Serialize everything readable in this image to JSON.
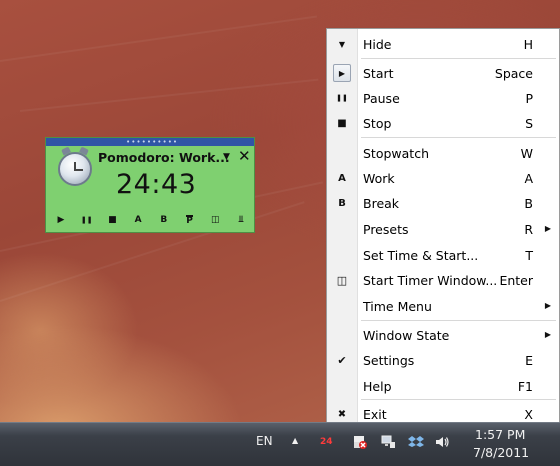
{
  "widget": {
    "title": "Pomodoro: Work...",
    "time": "24:43",
    "grip": "••••••••••",
    "controls": [
      {
        "name": "start-icon",
        "glyph": "▶"
      },
      {
        "name": "pause-icon",
        "glyph": "❚❚"
      },
      {
        "name": "stop-icon",
        "glyph": "■"
      },
      {
        "name": "work-icon",
        "glyph": "A"
      },
      {
        "name": "break-icon",
        "glyph": "B"
      },
      {
        "name": "presets-icon",
        "glyph": "P"
      },
      {
        "name": "timer-window-icon",
        "glyph": "◫"
      },
      {
        "name": "pin-icon",
        "glyph": "⫫"
      }
    ]
  },
  "menu": {
    "hide": {
      "label": "Hide",
      "shortcut": "H",
      "icon": "▼"
    },
    "start": {
      "label": "Start",
      "shortcut": "Space",
      "icon": "▶"
    },
    "pause": {
      "label": "Pause",
      "shortcut": "P",
      "icon": "❚❚"
    },
    "stop": {
      "label": "Stop",
      "shortcut": "S",
      "icon": "■"
    },
    "stopwatch": {
      "label": "Stopwatch",
      "shortcut": "W"
    },
    "work": {
      "label": "Work",
      "shortcut": "A",
      "icon": "A"
    },
    "break": {
      "label": "Break",
      "shortcut": "B",
      "icon": "B"
    },
    "presets": {
      "label": "Presets",
      "shortcut": "R"
    },
    "set_time": {
      "label": "Set Time & Start...",
      "shortcut": "T"
    },
    "start_timer_window": {
      "label": "Start Timer Window...",
      "shortcut": "Enter",
      "icon": "◫"
    },
    "time_menu": {
      "label": "Time Menu"
    },
    "window_state": {
      "label": "Window State"
    },
    "settings": {
      "label": "Settings",
      "shortcut": "E",
      "icon": "✔"
    },
    "help": {
      "label": "Help",
      "shortcut": "F1"
    },
    "exit": {
      "label": "Exit",
      "shortcut": "X",
      "icon": "✖"
    },
    "submenu_arrow": "▶"
  },
  "taskbar": {
    "language": "EN",
    "tray_up": "▲",
    "timer_badge": "24",
    "time": "1:57 PM",
    "date": "7/8/2011"
  }
}
